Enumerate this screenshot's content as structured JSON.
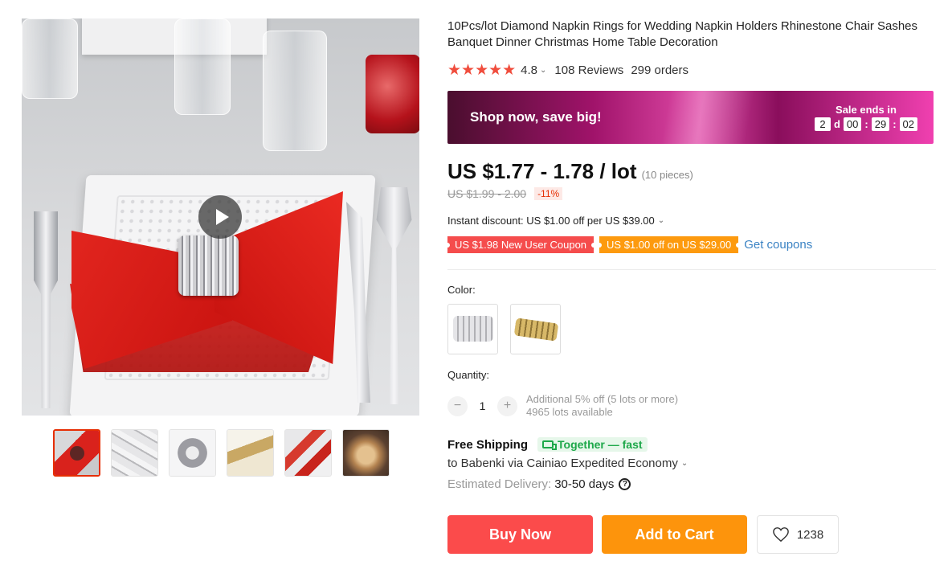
{
  "product": {
    "title": "10Pcs/lot Diamond Napkin Rings for Wedding Napkin Holders Rhinestone Chair Sashes Banquet Dinner Christmas Home Table Decoration",
    "rating": "4.8",
    "reviews": "108 Reviews",
    "orders": "299 orders"
  },
  "banner": {
    "text": "Shop now, save big!",
    "sale_ends": "Sale ends in",
    "countdown": {
      "days": "2",
      "d_label": "d",
      "hours": "00",
      "minutes": "29",
      "seconds": "02",
      "sep": ":"
    }
  },
  "price": {
    "current": "US $1.77 - 1.78 / lot",
    "pieces": "(10 pieces)",
    "original": "US $1.99 - 2.00",
    "discount": "-11%"
  },
  "promos": {
    "instant_discount": "Instant discount: US $1.00 off per US $39.00",
    "coupon_1": "US $1.98 New User Coupon",
    "coupon_2": "US $1.00 off on US $29.00",
    "get_coupons": "Get coupons"
  },
  "options": {
    "color_label": "Color:",
    "swatches": [
      "silver",
      "gold"
    ]
  },
  "quantity": {
    "label": "Quantity:",
    "minus": "−",
    "value": "1",
    "plus": "+",
    "additional": "Additional 5% off (5 lots or more)",
    "available": "4965 lots available"
  },
  "shipping": {
    "free": "Free Shipping",
    "together": "Together — fast",
    "to": "to Babenki via Cainiao Expedited Economy",
    "est_label": "Estimated Delivery:",
    "est_days": "30-50 days",
    "help": "?"
  },
  "actions": {
    "buy_now": "Buy Now",
    "add_to_cart": "Add to Cart",
    "wishlist_count": "1238"
  },
  "colors": {
    "accent_red": "#fb4b4b",
    "accent_orange": "#fd940c",
    "star": "#f04d3d",
    "link": "#3b83c4",
    "green": "#1ea84a"
  },
  "icons": [
    "play-icon",
    "star-icon",
    "chevron-down-icon",
    "truck-icon",
    "help-icon",
    "heart-icon"
  ]
}
